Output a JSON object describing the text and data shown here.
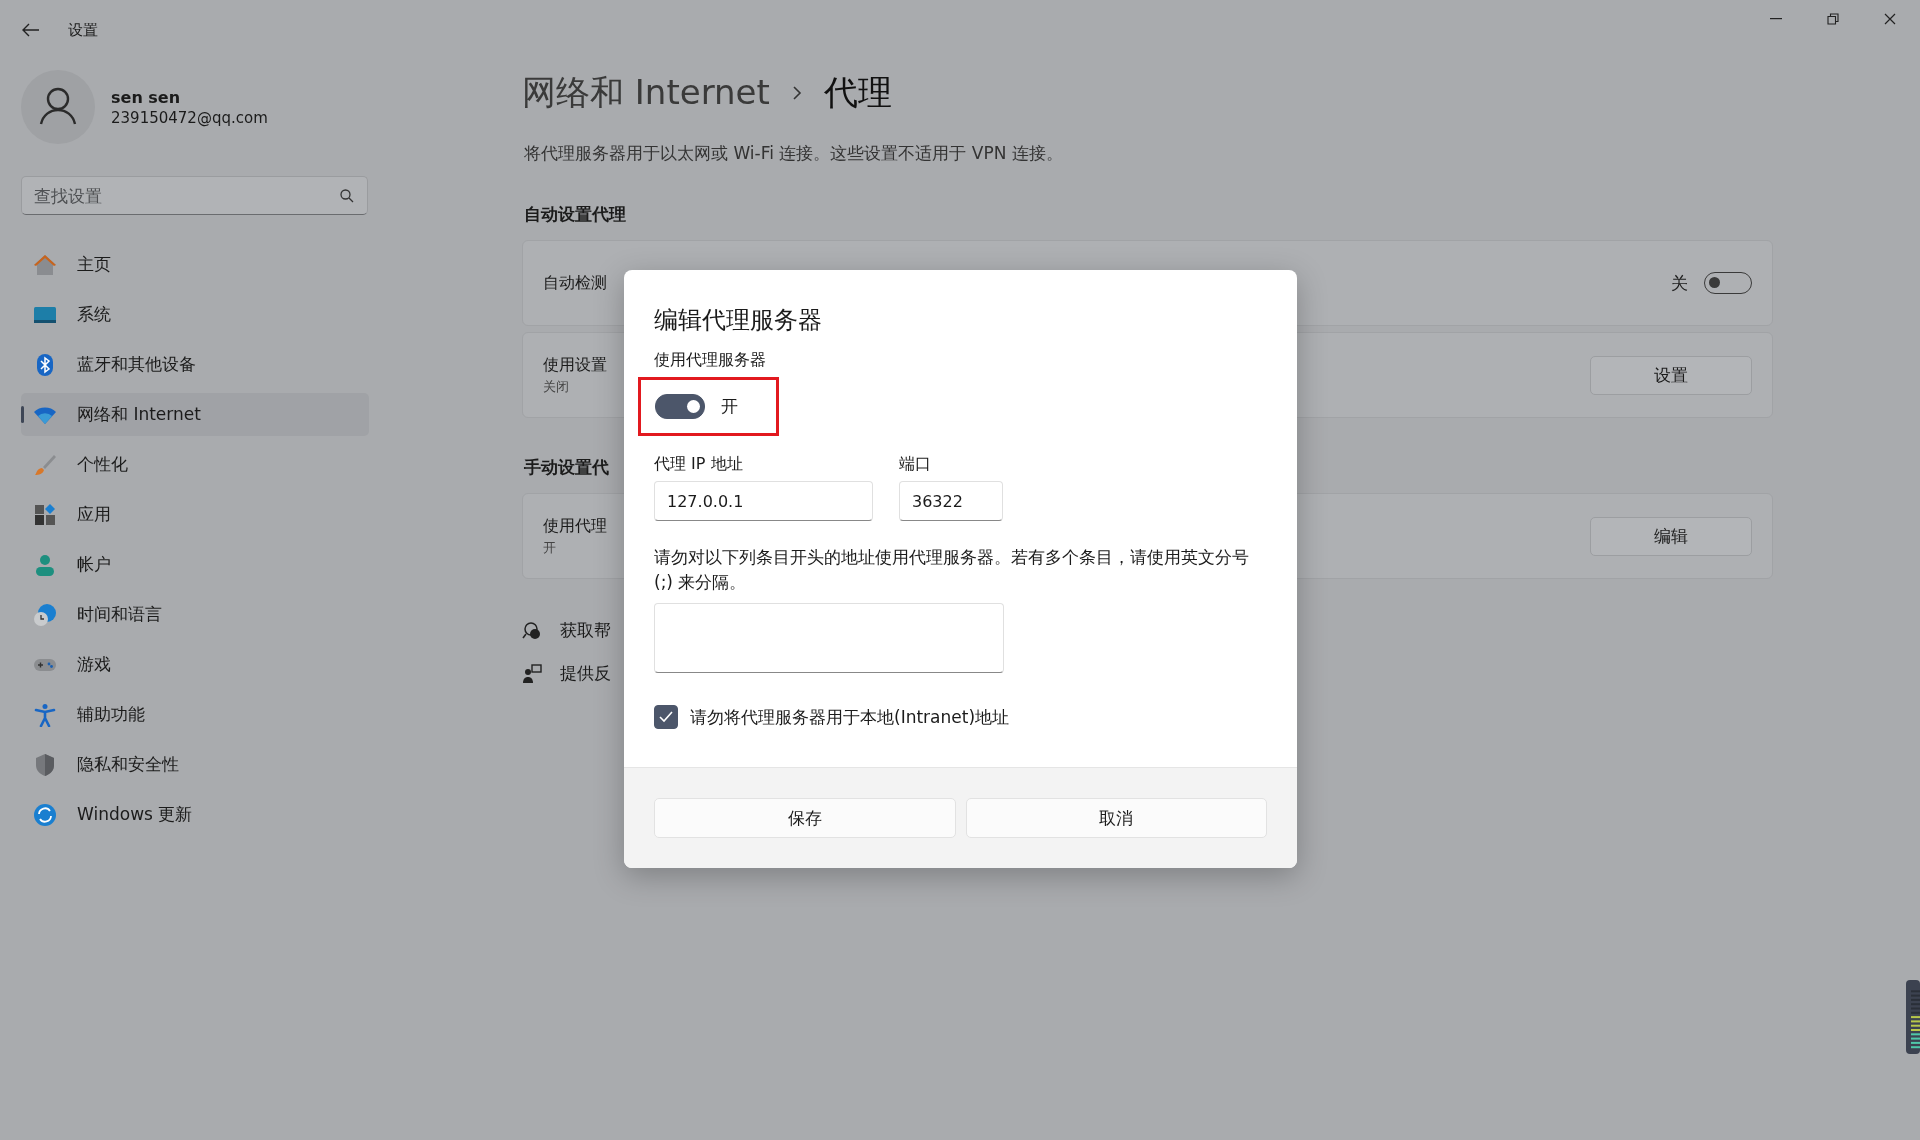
{
  "window": {
    "title": "设置"
  },
  "user": {
    "name": "sen sen",
    "email": "239150472@qq.com"
  },
  "search": {
    "placeholder": "查找设置"
  },
  "nav": [
    {
      "label": "主页",
      "selected": false
    },
    {
      "label": "系统",
      "selected": false
    },
    {
      "label": "蓝牙和其他设备",
      "selected": false
    },
    {
      "label": "网络和 Internet",
      "selected": true
    },
    {
      "label": "个性化",
      "selected": false
    },
    {
      "label": "应用",
      "selected": false
    },
    {
      "label": "帐户",
      "selected": false
    },
    {
      "label": "时间和语言",
      "selected": false
    },
    {
      "label": "游戏",
      "selected": false
    },
    {
      "label": "辅助功能",
      "selected": false
    },
    {
      "label": "隐私和安全性",
      "selected": false
    },
    {
      "label": "Windows 更新",
      "selected": false
    }
  ],
  "page": {
    "breadcrumb": [
      "网络和 Internet",
      "代理"
    ],
    "description": "将代理服务器用于以太网或 Wi-Fi 连接。这些设置不适用于 VPN 连接。"
  },
  "sections": [
    {
      "heading": "自动设置代理",
      "cards": [
        {
          "kind": "toggle",
          "title": "自动检测",
          "state_label": "关",
          "on": false
        },
        {
          "kind": "button",
          "title": "使用设置",
          "subtitle": "关闭",
          "button": "设置"
        }
      ]
    },
    {
      "heading": "手动设置代",
      "cards": [
        {
          "kind": "button",
          "title": "使用代理",
          "subtitle": "开",
          "button": "编辑"
        }
      ]
    }
  ],
  "help_links": [
    {
      "kind": "help",
      "label": "获取帮"
    },
    {
      "kind": "feedback",
      "label": "提供反"
    }
  ],
  "dialog": {
    "title": "编辑代理服务器",
    "toggle_label": "使用代理服务器",
    "proxy_on": true,
    "toggle_state": "开",
    "highlighted": true,
    "ip_label": "代理 IP 地址",
    "ip": "127.0.0.1",
    "port_label": "端口",
    "port": "36322",
    "exceptions_note": "请勿对以下列条目开头的地址使用代理服务器。若有多个条目，请使用英文分号 (;) 来分隔。",
    "local_bypass_label": "请勿将代理服务器用于本地(Intranet)地址",
    "local_bypass": true,
    "buttons": [
      "保存",
      "取消"
    ]
  }
}
